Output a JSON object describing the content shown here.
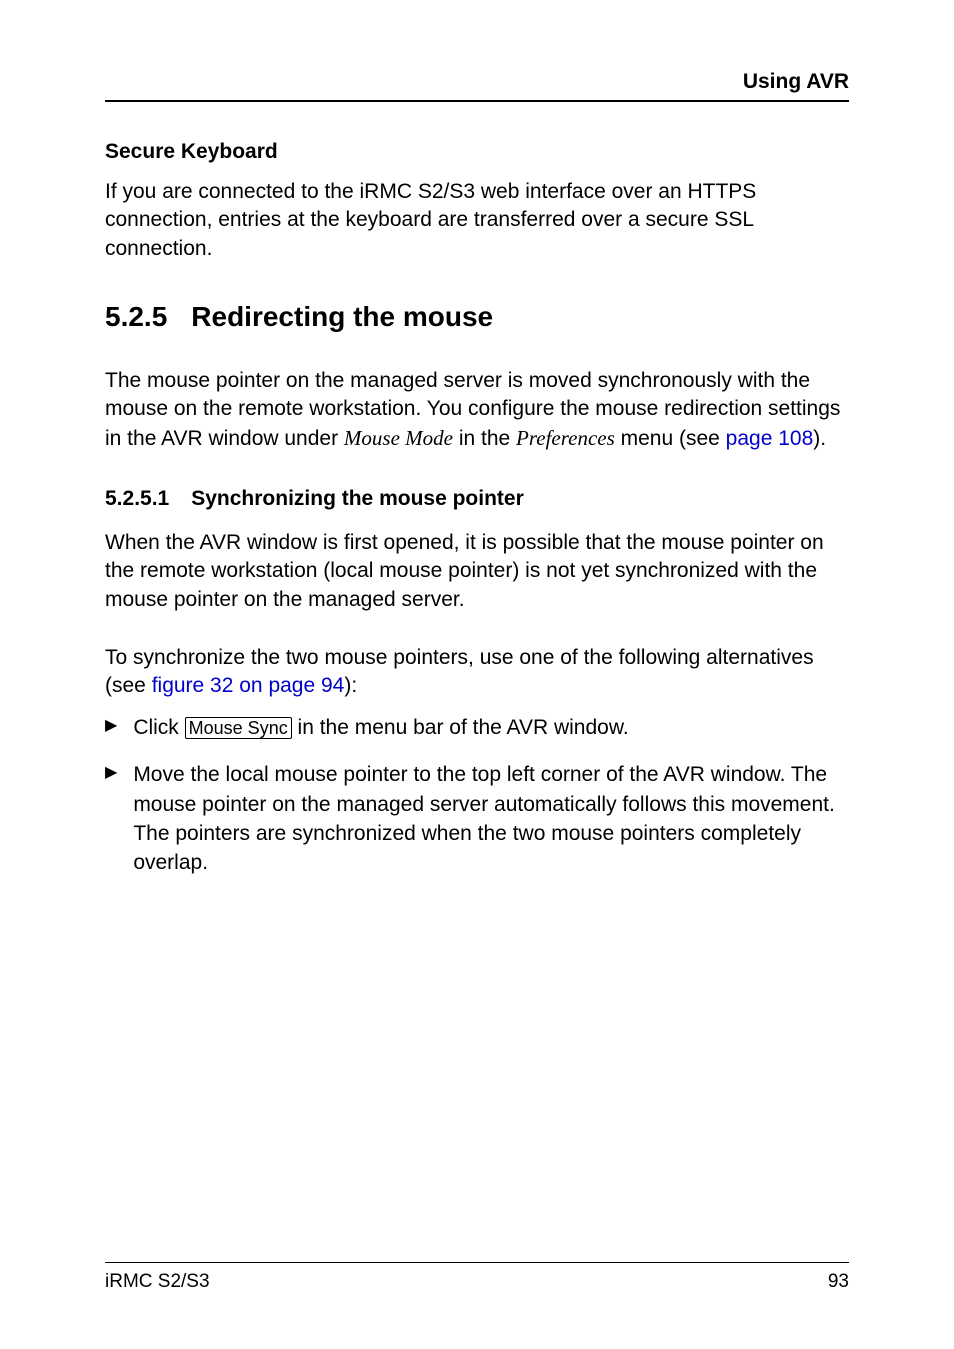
{
  "header": {
    "title": "Using AVR"
  },
  "secure_keyboard": {
    "heading": "Secure Keyboard",
    "para": "If you are connected to the iRMC S2/S3 web interface over an HTTPS connection, entries at the keyboard are transferred over a secure SSL connection."
  },
  "section": {
    "num": "5.2.5",
    "title": "Redirecting the mouse",
    "intro_pre": "The mouse pointer on the managed server is moved synchronously with the mouse on the remote workstation. You configure the mouse redirection settings in the AVR window under ",
    "intro_it1": "Mouse Mode",
    "intro_mid": " in the ",
    "intro_it2": "Preferences",
    "intro_post1": " menu (see ",
    "intro_link": "page 108",
    "intro_post2": ")."
  },
  "subsection": {
    "num": "5.2.5.1",
    "title": "Synchronizing the mouse pointer",
    "p1": "When the AVR window is first opened, it is possible that the mouse pointer on the remote workstation (local mouse pointer) is not yet synchronized with the mouse pointer on the managed server.",
    "p2_pre": "To synchronize the two mouse pointers, use one of the following alternatives (see ",
    "p2_link": "figure 32 on page 94",
    "p2_post": "):",
    "bullet1_pre": "Click ",
    "bullet1_btn": "Mouse Sync",
    "bullet1_post": " in the menu bar of the AVR window.",
    "bullet2": "Move the local mouse pointer to the top left corner of the AVR window. The mouse pointer on the managed server automatically follows this movement. The pointers are synchronized when the two mouse pointers completely overlap."
  },
  "footer": {
    "left": "iRMC S2/S3",
    "right": "93"
  }
}
